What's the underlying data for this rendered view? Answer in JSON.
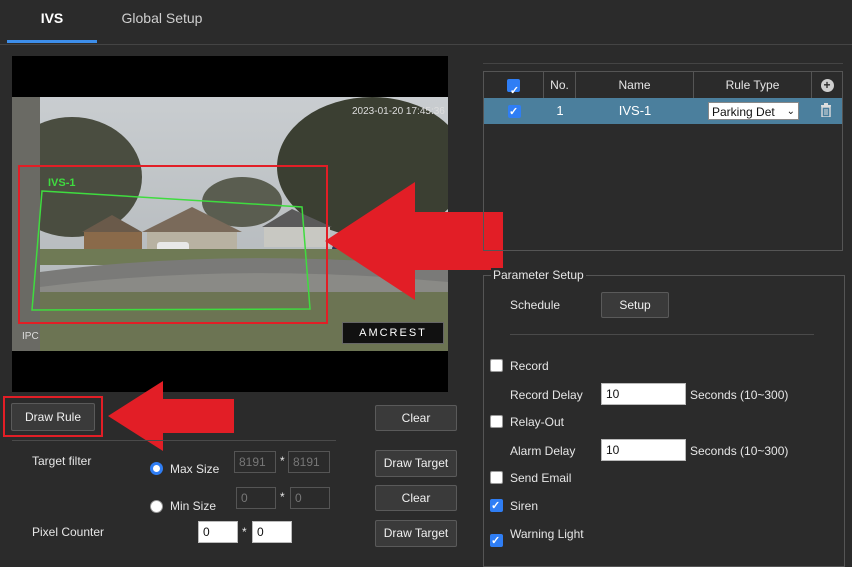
{
  "tabs": [
    {
      "label": "IVS",
      "active": true
    },
    {
      "label": "Global Setup",
      "active": false
    }
  ],
  "video": {
    "timestamp": "2023-01-20 17:45:36",
    "camera_label": "IPC",
    "brand_logo": "AMCREST",
    "rule_overlay_label": "IVS-1"
  },
  "left_controls": {
    "draw_rule_label": "Draw Rule",
    "clear_label_1": "Clear",
    "target_filter_label": "Target filter",
    "max_size_label": "Max Size",
    "max_size_selected": true,
    "max_w": "8191",
    "max_h": "8191",
    "min_size_label": "Min Size",
    "min_w": "0",
    "min_h": "0",
    "times_symbol": "*",
    "draw_target_label_1": "Draw Target",
    "clear_label_2": "Clear",
    "pixel_counter_label": "Pixel Counter",
    "pixel_w": "0",
    "pixel_h": "0",
    "draw_target_label_2": "Draw Target"
  },
  "rules_table": {
    "headers": {
      "no": "No.",
      "name": "Name",
      "rule_type": "Rule Type"
    },
    "rows": [
      {
        "checked": true,
        "no": "1",
        "name": "IVS-1",
        "rule_type": "Parking Det"
      }
    ]
  },
  "parameter_setup": {
    "title": "Parameter Setup",
    "schedule_label": "Schedule",
    "setup_button": "Setup",
    "record_label": "Record",
    "record_checked": false,
    "record_delay_label": "Record Delay",
    "record_delay_value": "10",
    "record_delay_unit": "Seconds (10~300)",
    "relay_out_label": "Relay-Out",
    "relay_out_checked": false,
    "alarm_delay_label": "Alarm Delay",
    "alarm_delay_value": "10",
    "alarm_delay_unit": "Seconds (10~300)",
    "send_email_label": "Send Email",
    "send_email_checked": false,
    "siren_label": "Siren",
    "siren_checked": true,
    "warning_light_label": "Warning Light",
    "warning_light_checked": true
  },
  "colors": {
    "accent": "#3d8eea",
    "highlight_red": "#e21e26",
    "selected_row": "#4b7f9d",
    "rule_line": "#3fdc3f"
  }
}
